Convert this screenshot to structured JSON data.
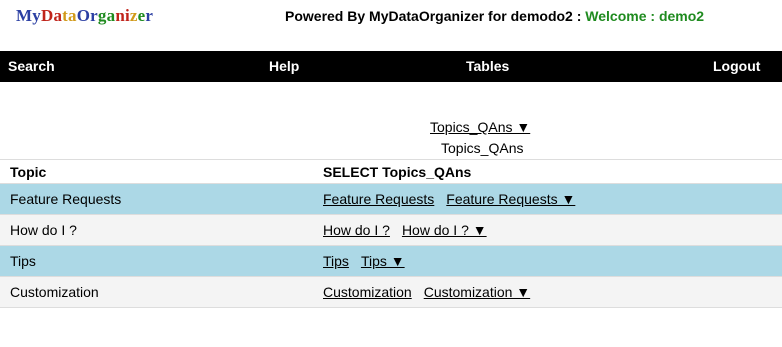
{
  "logo": {
    "letters": [
      {
        "t": "M",
        "color": "#2b3fa3"
      },
      {
        "t": "y",
        "color": "#2b3fa3"
      },
      {
        "t": "D",
        "color": "#c0241b"
      },
      {
        "t": "a",
        "color": "#c0241b"
      },
      {
        "t": "t",
        "color": "#d19a1a"
      },
      {
        "t": "a",
        "color": "#d19a1a"
      },
      {
        "t": "O",
        "color": "#2b3fa3"
      },
      {
        "t": "r",
        "color": "#2b3fa3"
      },
      {
        "t": "g",
        "color": "#1f8b1f"
      },
      {
        "t": "a",
        "color": "#1f8b1f"
      },
      {
        "t": "n",
        "color": "#c0241b"
      },
      {
        "t": "i",
        "color": "#c0241b"
      },
      {
        "t": "z",
        "color": "#d19a1a"
      },
      {
        "t": "e",
        "color": "#1f8b1f"
      },
      {
        "t": "r",
        "color": "#2b3fa3"
      }
    ]
  },
  "header": {
    "powered_text": "Powered By MyDataOrganizer for demodo2 : ",
    "welcome_text": "Welcome : demo2",
    "welcome_color": "#1f8b1f"
  },
  "nav": {
    "search": "Search",
    "help": "Help",
    "tables": "Tables",
    "logout": "Logout"
  },
  "topics": {
    "dropdown_label": "Topics_QAns ▼",
    "label": "Topics_QAns"
  },
  "table": {
    "headers": {
      "topic": "Topic",
      "select": "SELECT Topics_QAns"
    },
    "rows": [
      {
        "topic": "Feature Requests",
        "link1": "Feature Requests",
        "link2": "Feature Requests ▼"
      },
      {
        "topic": "How do I ?",
        "link1": "How do I ?",
        "link2": "How do I ? ▼"
      },
      {
        "topic": "Tips",
        "link1": "Tips",
        "link2": "Tips ▼"
      },
      {
        "topic": "Customization",
        "link1": "Customization",
        "link2": "Customization ▼"
      }
    ],
    "colors": {
      "blue_row": "#acd8e6",
      "grey_row": "#f4f4f4"
    }
  }
}
